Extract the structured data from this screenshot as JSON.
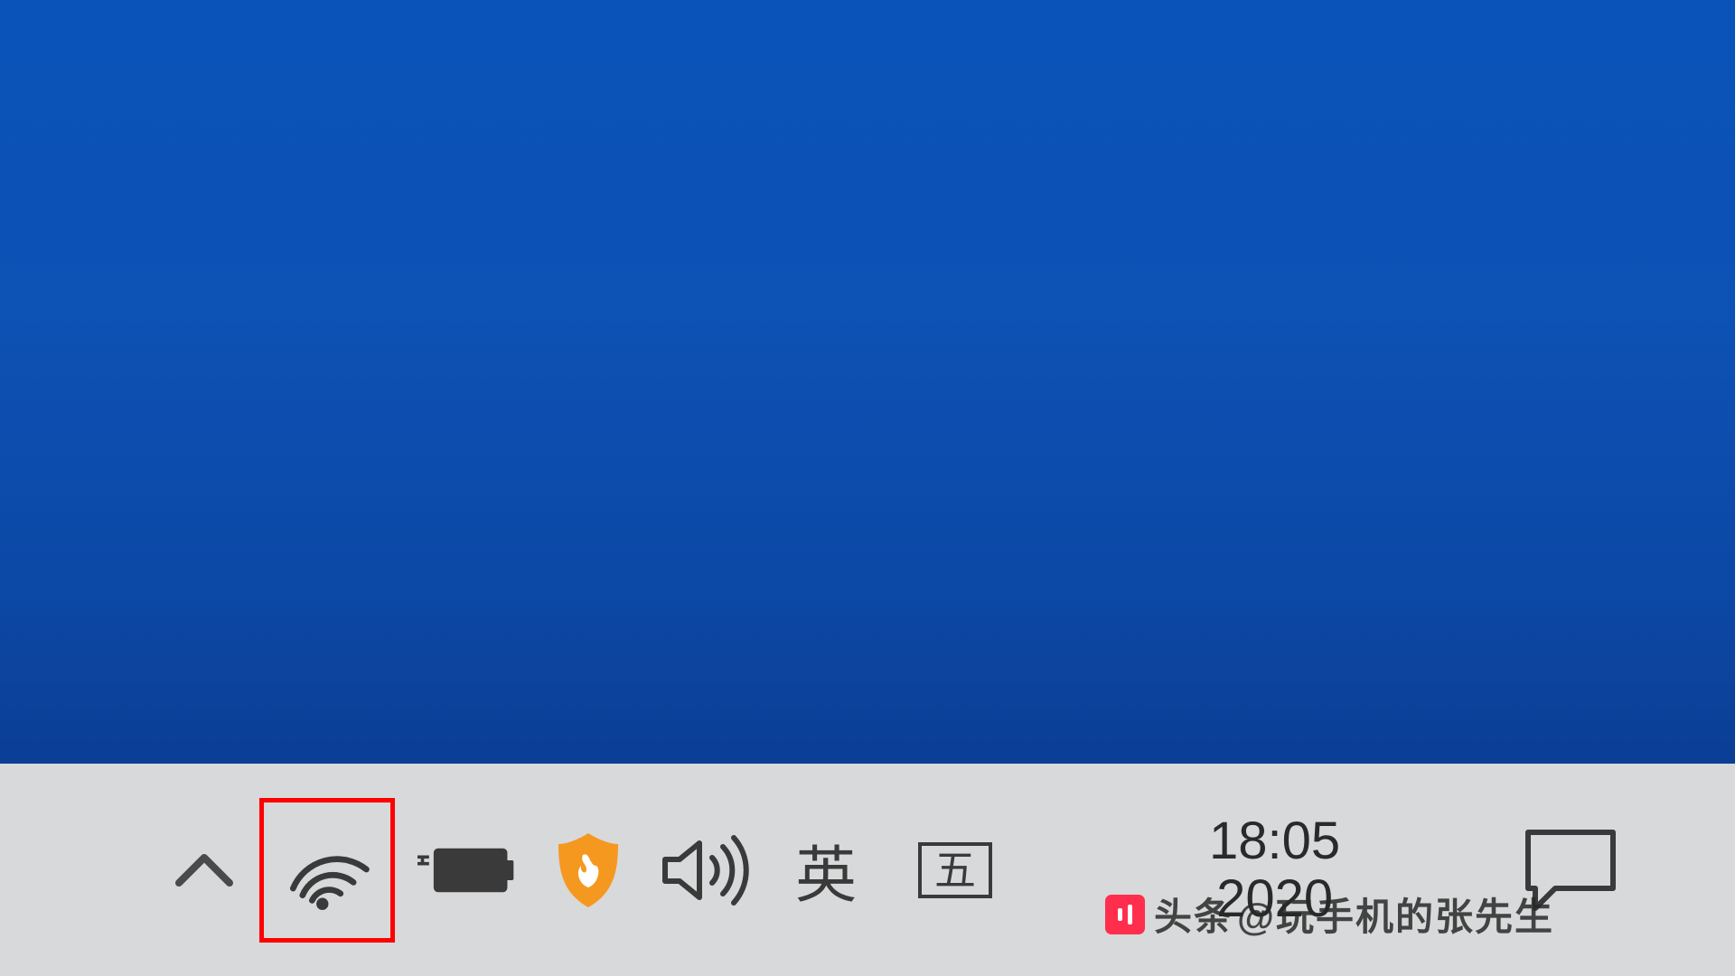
{
  "taskbar": {
    "ime_language": "英",
    "ime_mode": "五",
    "clock": {
      "time": "18:05",
      "date": "2020"
    },
    "icons": {
      "show_hidden": "show-hidden-icons",
      "wifi": "wifi-icon",
      "battery": "battery-charging-icon",
      "firewall": "firewall-icon",
      "volume": "volume-icon",
      "action_center": "action-center-icon"
    }
  },
  "watermark": {
    "brand": "头条",
    "handle": "@玩手机的张先生"
  }
}
